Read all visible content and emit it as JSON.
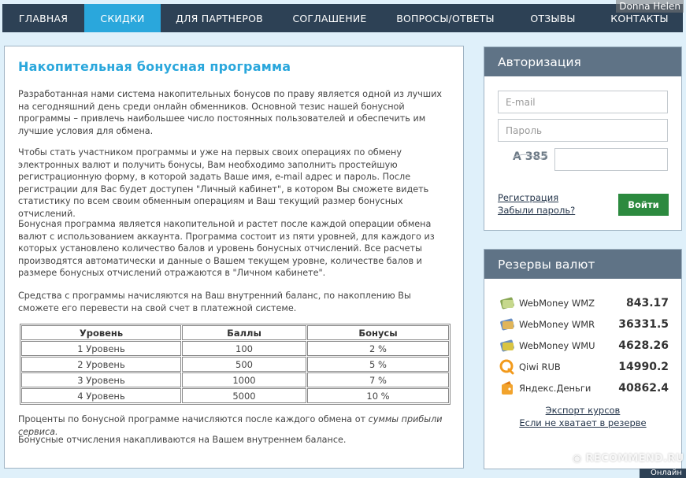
{
  "watermark_user": "Donna Helen",
  "watermark_site": "RECOMMEND.RU",
  "nav": {
    "items": [
      {
        "label": "ГЛАВНАЯ"
      },
      {
        "label": "СКИДКИ"
      },
      {
        "label": "ДЛЯ ПАРТНЕРОВ"
      },
      {
        "label": "СОГЛАШЕНИЕ"
      },
      {
        "label": "ВОПРОСЫ/ОТВЕТЫ"
      },
      {
        "label": "ОТЗЫВЫ"
      },
      {
        "label": "КОНТАКТЫ"
      }
    ],
    "active_index": 1
  },
  "main": {
    "title": "Накопительная бонусная программа",
    "paragraphs": [
      "Разработанная нами система накопительных бонусов по праву является одной из лучших на сегодняшний день среди онлайн обменников. Основной тезис нашей бонусной программы – привлечь наибольшее число постоянных пользователей и обеспечить им лучшие условия для обмена.",
      "Чтобы стать участником программы и уже на первых своих операциях по обмену электронных валют и получить бонусы, Вам необходимо заполнить простейшую регистрационную форму, в которой задать Ваше имя, e-mail адрес и пароль. После регистрации для Вас будет доступен \"Личный кабинет\", в котором Вы сможете видеть статистику по всем своим обменным операциям и Ваш текущий размер бонусных отчислений.",
      "Бонусная программа является накопительной и растет после каждой операции обмена валют с использованием аккаунта. Программа состоит из пяти уровней, для каждого из которых установлено количество балов и уровень бонусных отчислений. Все расчеты производятся автоматически и данные о Вашем текущем уровне, количестве балов и размере бонусных отчислений отражаются в \"Личном кабинете\".",
      "Средства с программы начисляются на Ваш внутренний баланс, по накоплению Вы сможете его перевести на свой счет в платежной системе."
    ],
    "table": {
      "headers": [
        "Уровень",
        "Баллы",
        "Бонусы"
      ],
      "rows": [
        [
          "1 Уровень",
          "100",
          "2 %"
        ],
        [
          "2 Уровень",
          "500",
          "5 %"
        ],
        [
          "3 Уровень",
          "1000",
          "7 %"
        ],
        [
          "4 Уровень",
          "5000",
          "10 %"
        ]
      ]
    },
    "note_prefix": "Проценты по бонусной программе начисляются после каждого обмена от ",
    "note_italic": "суммы прибыли сервиса.",
    "note_final": "Бонусные отчисления накапливаются на Вашем внутреннем балансе."
  },
  "auth": {
    "title": "Авторизация",
    "email_placeholder": "E-mail",
    "password_placeholder": "Пароль",
    "captcha_text": "A 385",
    "register_link": "Регистрация",
    "forgot_link": "Забыли пароль?",
    "login_button": "Войти"
  },
  "reserves": {
    "title": "Резервы валют",
    "items": [
      {
        "name": "WebMoney WMZ",
        "amount": "843.17",
        "icon": "webmoney-wmz-icon",
        "color": "#8aa856"
      },
      {
        "name": "WebMoney WMR",
        "amount": "36331.5",
        "icon": "webmoney-wmr-icon",
        "color": "#6a8fc2"
      },
      {
        "name": "WebMoney WMU",
        "amount": "4628.26",
        "icon": "webmoney-wmu-icon",
        "color": "#d9c443"
      },
      {
        "name": "Qiwi RUB",
        "amount": "14990.2",
        "icon": "qiwi-icon",
        "color": "#f29a1c"
      },
      {
        "name": "Яндекс.Деньги",
        "amount": "40862.4",
        "icon": "yandex-money-icon",
        "color": "#f2a32c"
      }
    ],
    "export_link": "Экспорт курсов",
    "shortage_link": "Если не хватает в резерве"
  },
  "corner_button": "Онлайн"
}
